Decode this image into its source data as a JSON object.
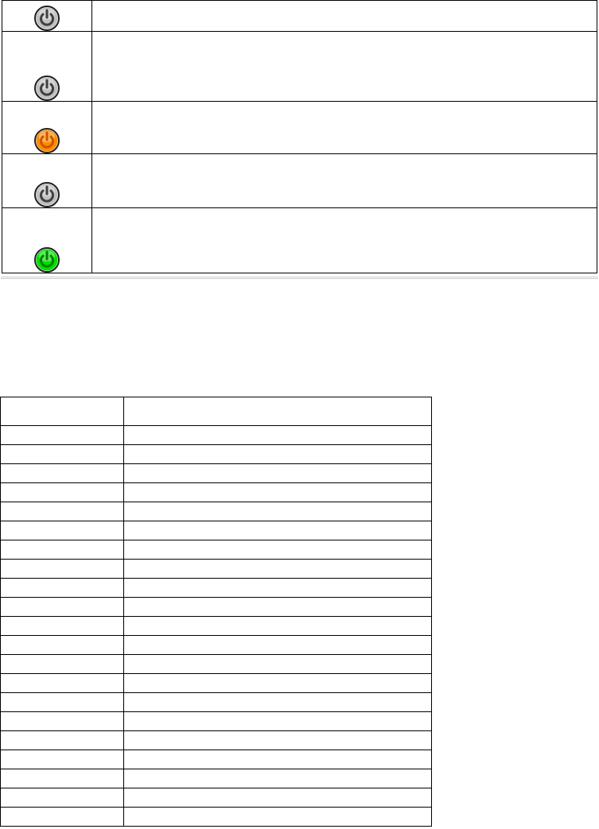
{
  "top_table": {
    "rows": [
      {
        "icon": "power-icon",
        "icon_color": "gray",
        "content": ""
      },
      {
        "icon": "power-icon",
        "icon_color": "gray",
        "content": ""
      },
      {
        "icon": "power-icon",
        "icon_color": "orange",
        "content": ""
      },
      {
        "icon": "power-icon",
        "icon_color": "gray",
        "content": ""
      },
      {
        "icon": "power-icon",
        "icon_color": "green",
        "content": ""
      }
    ]
  },
  "icon_colors": {
    "gray": {
      "fill": "#c0c0c0",
      "stroke": "#404040"
    },
    "orange": {
      "fill": "#ff8c00",
      "stroke": "#cc5500"
    },
    "green": {
      "fill": "#00e000",
      "stroke": "#008000"
    }
  },
  "bottom_table": {
    "rows": [
      {
        "col1": "",
        "col2": ""
      },
      {
        "col1": "",
        "col2": ""
      },
      {
        "col1": "",
        "col2": ""
      },
      {
        "col1": "",
        "col2": ""
      },
      {
        "col1": "",
        "col2": ""
      },
      {
        "col1": "",
        "col2": ""
      },
      {
        "col1": "",
        "col2": ""
      },
      {
        "col1": "",
        "col2": ""
      },
      {
        "col1": "",
        "col2": ""
      },
      {
        "col1": "",
        "col2": ""
      },
      {
        "col1": "",
        "col2": ""
      },
      {
        "col1": "",
        "col2": ""
      },
      {
        "col1": "",
        "col2": ""
      },
      {
        "col1": "",
        "col2": ""
      },
      {
        "col1": "",
        "col2": ""
      },
      {
        "col1": "",
        "col2": ""
      },
      {
        "col1": "",
        "col2": ""
      },
      {
        "col1": "",
        "col2": ""
      },
      {
        "col1": "",
        "col2": ""
      },
      {
        "col1": "",
        "col2": ""
      },
      {
        "col1": "",
        "col2": ""
      },
      {
        "col1": "",
        "col2": ""
      }
    ]
  }
}
